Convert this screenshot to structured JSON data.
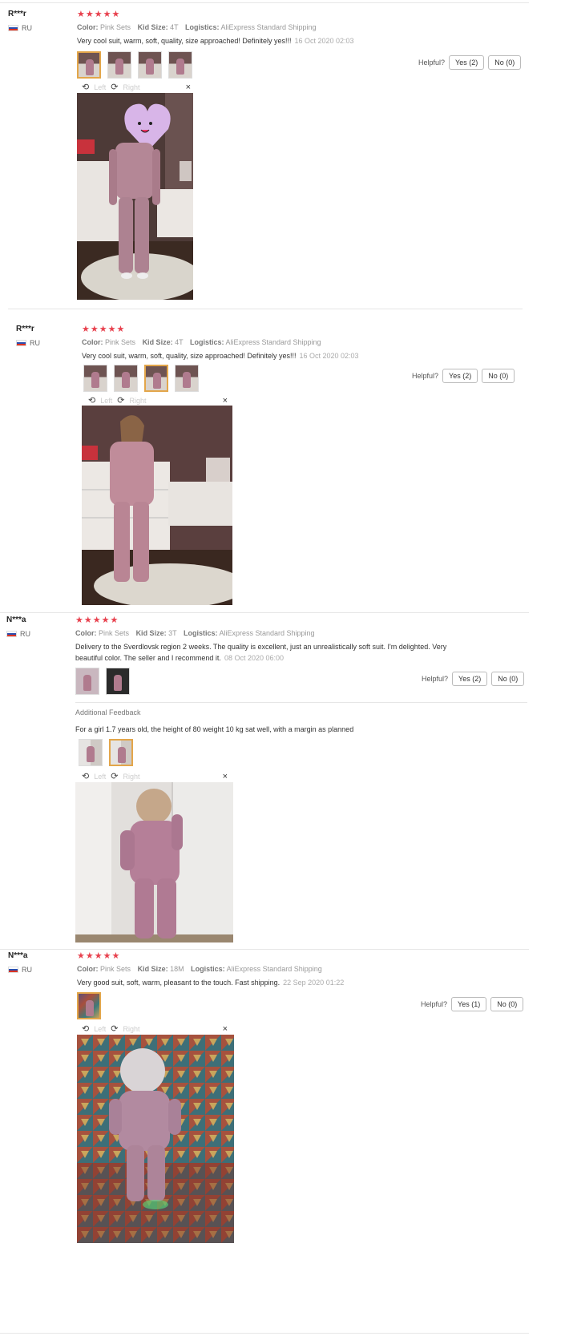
{
  "helpful_label": "Helpful?",
  "viewer": {
    "left": "Left",
    "right": "Right",
    "close": "×"
  },
  "labels": {
    "color": "Color:",
    "size": "Kid Size:",
    "logistics": "Logistics:"
  },
  "reviews": [
    {
      "user": "R***r",
      "country": "RU",
      "stars": "★★★★★",
      "color": "Pink Sets",
      "size": "4T",
      "logistics": "AliExpress Standard Shipping",
      "text": "Very cool suit, warm, soft, quality, size approached! Definitely yes!!!",
      "date": "16 Oct 2020 02:03",
      "yes": "Yes (2)",
      "no": "No (0)"
    },
    {
      "user": "R***r",
      "country": "RU",
      "stars": "★★★★★",
      "color": "Pink Sets",
      "size": "4T",
      "logistics": "AliExpress Standard Shipping",
      "text": "Very cool suit, warm, soft, quality, size approached! Definitely yes!!!",
      "date": "16 Oct 2020 02:03",
      "yes": "Yes (2)",
      "no": "No (0)"
    },
    {
      "user": "N***a",
      "country": "RU",
      "stars": "★★★★★",
      "color": "Pink Sets",
      "size": "3T",
      "logistics": "AliExpress Standard Shipping",
      "text_line1": "Delivery to the Sverdlovsk region 2 weeks. The quality is excellent, just an unrealistically soft suit. I'm delighted. Very",
      "text_line2": "beautiful color. The seller and I recommend it.",
      "date": "08 Oct 2020 06:00",
      "yes": "Yes (2)",
      "no": "No (0)",
      "additional_title": "Additional Feedback",
      "additional_text": "For a girl 1.7 years old, the height of 80 weight 10 kg sat well, with a margin as planned"
    },
    {
      "user": "N***a",
      "country": "RU",
      "stars": "★★★★★",
      "color": "Pink Sets",
      "size": "18M",
      "logistics": "AliExpress Standard Shipping",
      "text": "Very good suit, soft, warm, pleasant to the touch. Fast shipping.",
      "date": "22 Sep 2020 01:22",
      "yes": "Yes (1)",
      "no": "No (0)"
    }
  ]
}
